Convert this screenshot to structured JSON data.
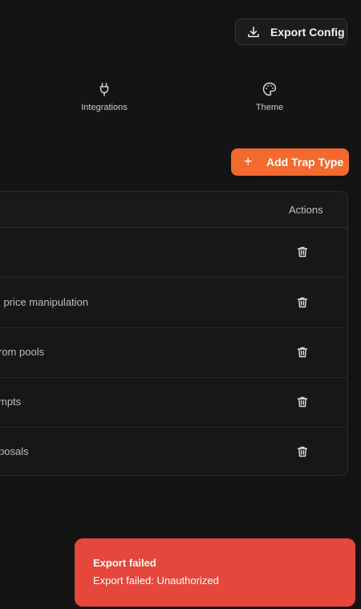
{
  "header": {
    "export_label": "Export Config"
  },
  "tabs": [
    {
      "label": "Integrations",
      "icon": "plug-icon"
    },
    {
      "label": "Theme",
      "icon": "palette-icon"
    }
  ],
  "toolbar": {
    "add_label": "Add Trap Type"
  },
  "table": {
    "actions_header": "Actions",
    "rows": [
      {
        "description": ""
      },
      {
        "description": "l price manipulation"
      },
      {
        "description": "rom pools"
      },
      {
        "description": "mpts"
      },
      {
        "description": "posals"
      }
    ]
  },
  "toast": {
    "title": "Export failed",
    "message": "Export failed: Unauthorized",
    "color": "#e5473c"
  },
  "colors": {
    "accent": "#f26a2d",
    "background": "#141414"
  }
}
